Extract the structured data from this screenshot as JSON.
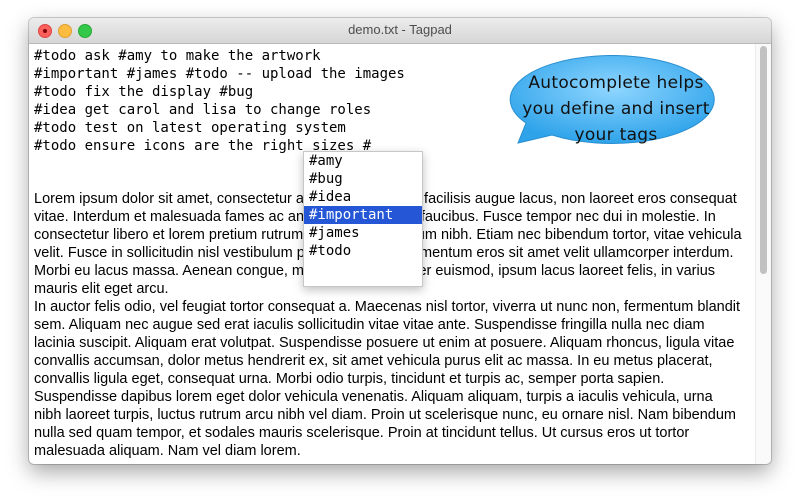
{
  "window": {
    "title": "demo.txt - Tagpad"
  },
  "editor": {
    "todo_lines": [
      "#todo ask #amy to make the artwork",
      "#important #james #todo -- upload the images",
      "#todo fix the display #bug",
      "#idea get carol and lisa to change roles",
      "#todo test on latest operating system",
      "#todo ensure icons are the right sizes #"
    ],
    "body": "Lorem ipsum dolor sit amet, consectetur adipiscing elit. Duis facilisis augue lacus, non laoreet eros consequat vitae. Interdum et malesuada fames ac ante ipsum primis in faucibus. Fusce tempor nec dui in molestie. In consectetur libero et lorem pretium rutrum. Curabitur eu rutrum nibh. Etiam nec bibendum tortor, vitae vehicula velit. Fusce in sollicitudin nisl vestibulum porta. Mauris condimentum eros sit amet velit ullamcorper interdum. Morbi eu lacus massa. Aenean congue, mauris et ullamcorper euismod, ipsum lacus laoreet felis, in varius mauris elit eget arcu.\nIn auctor felis odio, vel feugiat tortor consequat a. Maecenas nisl tortor, viverra ut nunc non, fermentum blandit sem. Aliquam nec augue sed erat iaculis sollicitudin vitae vitae ante. Suspendisse fringilla nulla nec diam lacinia suscipit. Aliquam erat volutpat. Suspendisse posuere ut enim at posuere. Aliquam rhoncus, ligula vitae convallis accumsan, dolor metus hendrerit ex, sit amet vehicula purus elit ac massa. In eu metus placerat, convallis ligula eget, consequat urna. Morbi odio turpis, tincidunt et turpis ac, semper porta sapien. Suspendisse dapibus lorem eget dolor vehicula venenatis. Aliquam aliquam, turpis a iaculis vehicula, urna nibh laoreet turpis, luctus rutrum arcu nibh vel diam. Proin ut scelerisque nunc, eu ornare nisl. Nam bibendum nulla sed quam tempor, et sodales mauris scelerisque. Proin at tincidunt tellus. Ut cursus eros ut tortor malesuada aliquam. Nam vel diam lorem."
  },
  "autocomplete": {
    "items": [
      "#amy",
      "#bug",
      "#idea",
      "#important",
      "#james",
      "#todo"
    ],
    "selected": "#important",
    "selected_color": "#2456d6"
  },
  "callout": {
    "lines": [
      "Autocomplete helps",
      "you define and insert",
      "your tags"
    ],
    "fill_color": "#3fb0f0"
  },
  "icons": {
    "close": "close-icon",
    "minimize": "minimize-icon",
    "zoom": "zoom-icon"
  }
}
